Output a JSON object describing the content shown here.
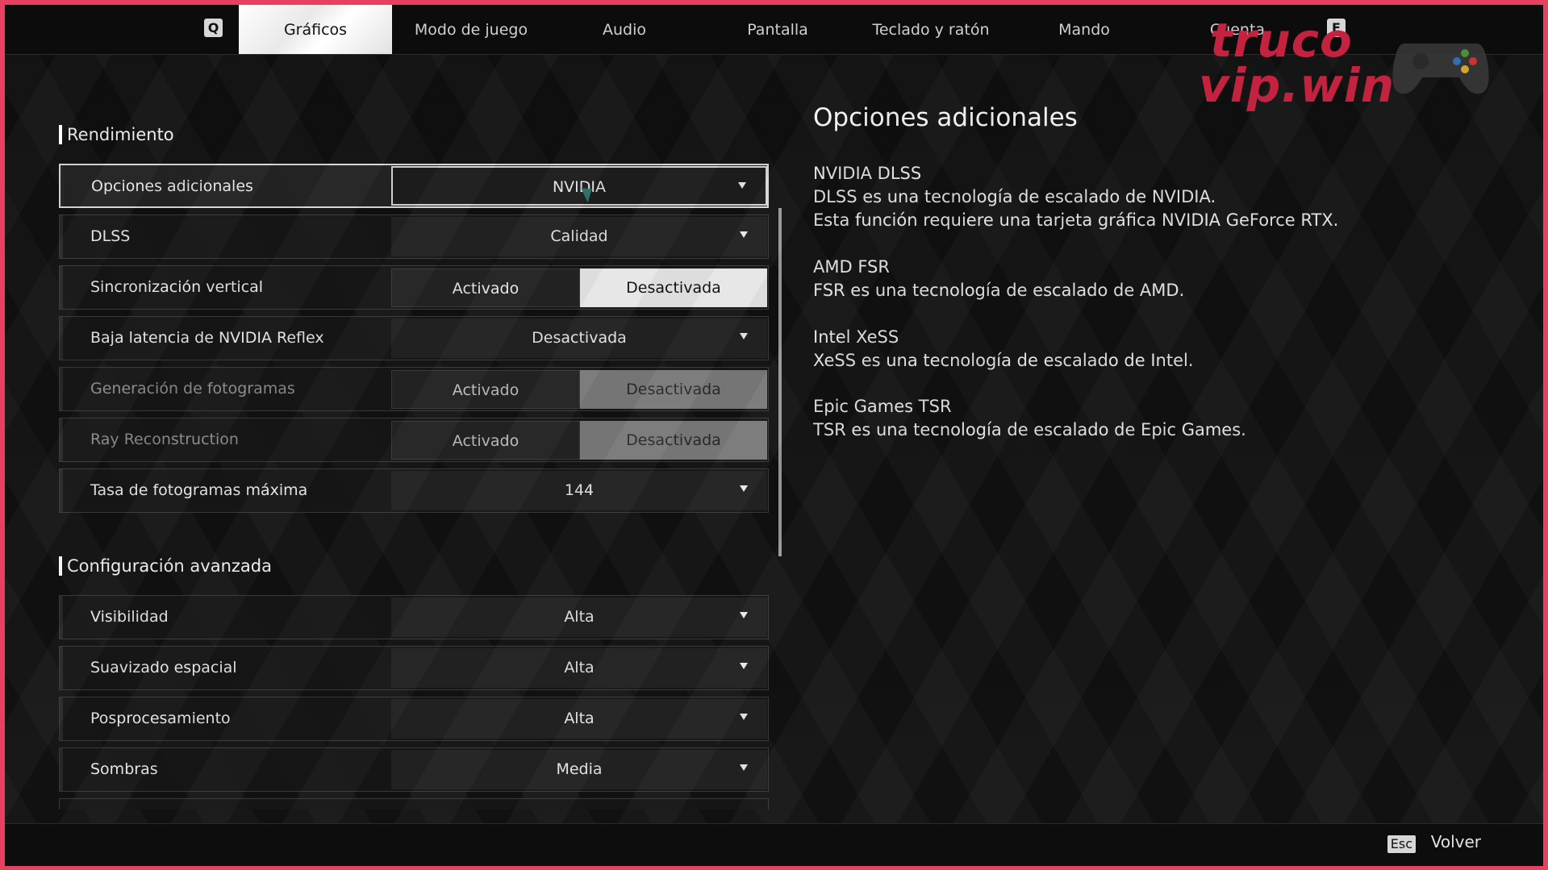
{
  "nav": {
    "prev_key": "Q",
    "next_key": "E",
    "tabs": [
      {
        "label": "Gráficos",
        "active": true
      },
      {
        "label": "Modo de juego"
      },
      {
        "label": "Audio"
      },
      {
        "label": "Pantalla"
      },
      {
        "label": "Teclado y ratón"
      },
      {
        "label": "Mando"
      },
      {
        "label": "Cuenta"
      }
    ]
  },
  "watermark": {
    "line1": "truco",
    "line2": "vip.win"
  },
  "sections": {
    "performance": {
      "title": "Rendimiento",
      "rows": [
        {
          "label": "Opciones adicionales",
          "value": "NVIDIA"
        },
        {
          "label": "DLSS",
          "value": "Calidad"
        },
        {
          "label": "Sincronización vertical",
          "option_on": "Activado",
          "option_off": "Desactivada",
          "selected": "Desactivada"
        },
        {
          "label": "Baja latencia de NVIDIA Reflex",
          "value": "Desactivada"
        },
        {
          "label": "Generación de fotogramas",
          "option_on": "Activado",
          "option_off": "Desactivada",
          "selected": "Desactivada"
        },
        {
          "label": "Ray Reconstruction",
          "option_on": "Activado",
          "option_off": "Desactivada",
          "selected": "Desactivada"
        },
        {
          "label": "Tasa de fotogramas máxima",
          "value": "144"
        }
      ]
    },
    "advanced": {
      "title": "Configuración avanzada",
      "rows": [
        {
          "label": "Visibilidad",
          "value": "Alta"
        },
        {
          "label": "Suavizado espacial",
          "value": "Alta"
        },
        {
          "label": "Posprocesamiento",
          "value": "Alta"
        },
        {
          "label": "Sombras",
          "value": "Media"
        }
      ]
    }
  },
  "panel": {
    "title": "Opciones adicionales",
    "blocks": [
      {
        "heading": "NVIDIA DLSS",
        "lines": [
          "DLSS es una tecnología de escalado de NVIDIA.",
          "Esta función requiere una tarjeta gráfica NVIDIA GeForce RTX."
        ]
      },
      {
        "heading": "AMD FSR",
        "lines": [
          "FSR es una tecnología de escalado de AMD."
        ]
      },
      {
        "heading": "Intel XeSS",
        "lines": [
          "XeSS es una tecnología de escalado de Intel."
        ]
      },
      {
        "heading": "Epic Games TSR",
        "lines": [
          "TSR es una tecnología de escalado de Epic Games."
        ]
      }
    ]
  },
  "footer": {
    "esc_key": "Esc",
    "back_label": "Volver"
  },
  "colors": {
    "border_accent": "#e8405f",
    "watermark": "#c3233f"
  }
}
